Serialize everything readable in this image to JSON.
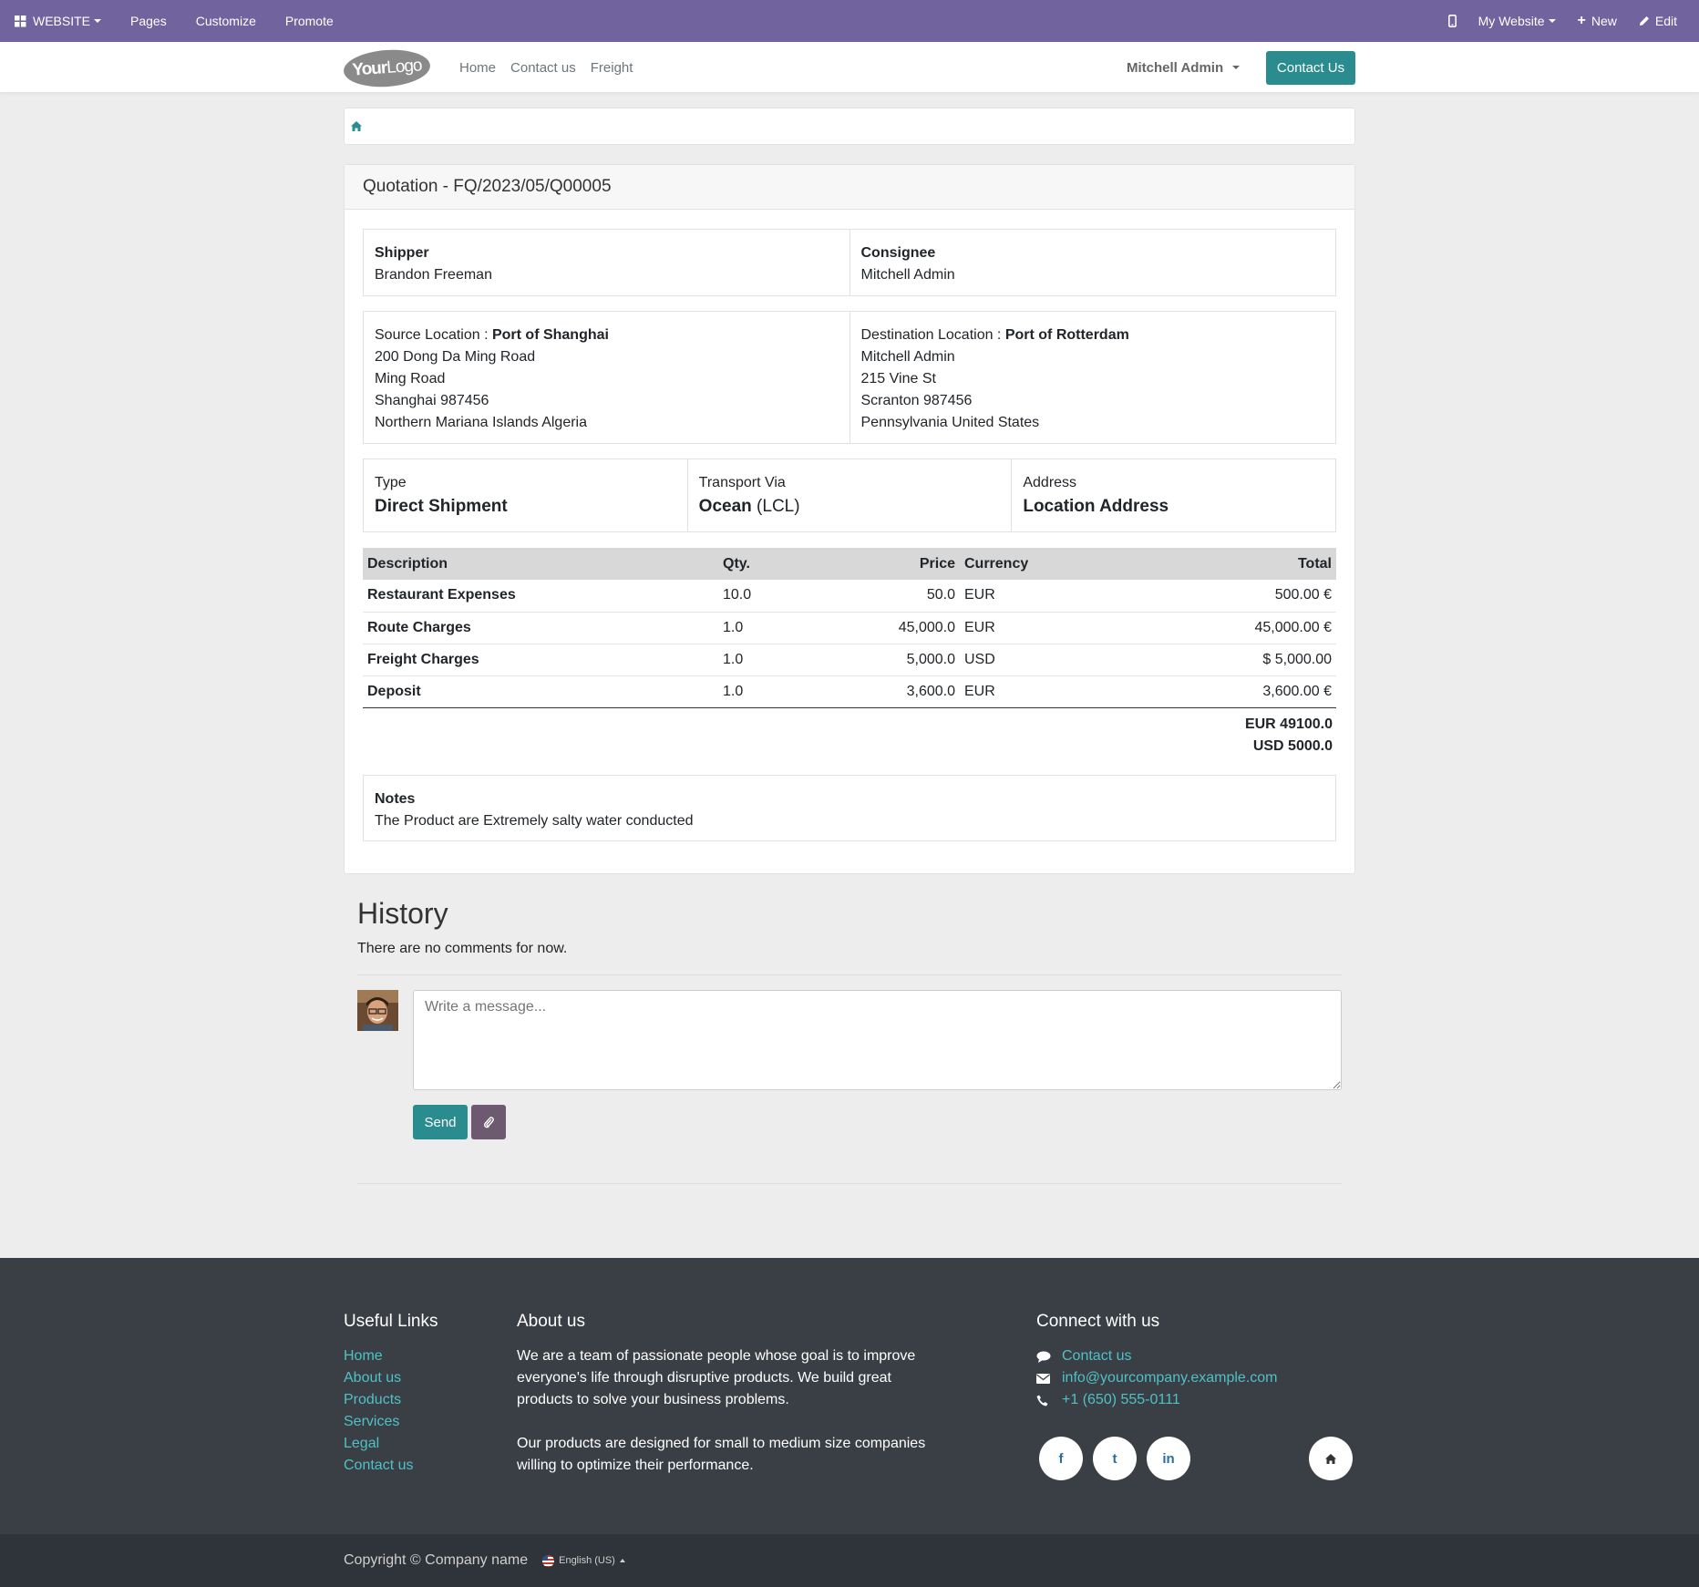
{
  "adminbar": {
    "website_label": "WEBSITE",
    "pages": "Pages",
    "customize": "Customize",
    "promote": "Promote",
    "my_website": "My Website",
    "new": "New",
    "edit": "Edit"
  },
  "header": {
    "logo_your": "Your",
    "logo_logo": "Logo",
    "nav": [
      "Home",
      "Contact us",
      "Freight"
    ],
    "user": "Mitchell Admin",
    "contact_button": "Contact Us"
  },
  "quotation": {
    "title": "Quotation - FQ/2023/05/Q00005",
    "shipper_label": "Shipper",
    "shipper": "Brandon Freeman",
    "consignee_label": "Consignee",
    "consignee": "Mitchell Admin",
    "source_label": "Source Location : ",
    "source_name": "Port of Shanghai",
    "source_lines": [
      "200 Dong Da Ming Road",
      "Ming Road",
      "Shanghai 987456",
      "Northern Mariana Islands Algeria"
    ],
    "dest_label": "Destination Location : ",
    "dest_name": "Port of Rotterdam",
    "dest_lines": [
      "Mitchell Admin",
      "215 Vine St",
      "Scranton 987456",
      "Pennsylvania United States"
    ],
    "type_label": "Type",
    "type_value": "Direct Shipment",
    "transport_label": "Transport Via",
    "transport_value": "Ocean",
    "transport_sub": "(LCL)",
    "address_label": "Address",
    "address_value": "Location Address",
    "columns": [
      "Description",
      "Qty.",
      "Price",
      "Currency",
      "Total"
    ],
    "lines": [
      {
        "description": "Restaurant Expenses",
        "qty": "10.0",
        "price": "50.0",
        "currency": "EUR",
        "total": "500.00 €"
      },
      {
        "description": "Route Charges",
        "qty": "1.0",
        "price": "45,000.0",
        "currency": "EUR",
        "total": "45,000.00 €"
      },
      {
        "description": "Freight Charges",
        "qty": "1.0",
        "price": "5,000.0",
        "currency": "USD",
        "total": "$ 5,000.00"
      },
      {
        "description": "Deposit",
        "qty": "1.0",
        "price": "3,600.0",
        "currency": "EUR",
        "total": "3,600.00 €"
      }
    ],
    "total_eur": "EUR 49100.0",
    "total_usd": "USD 5000.0",
    "notes_label": "Notes",
    "notes": "The Product are Extremely salty water conducted"
  },
  "history": {
    "title": "History",
    "empty": "There are no comments for now.",
    "placeholder": "Write a message...",
    "send": "Send"
  },
  "footer": {
    "useful_title": "Useful Links",
    "useful_links": [
      "Home",
      "About us",
      "Products",
      "Services",
      "Legal",
      "Contact us"
    ],
    "about_title": "About us",
    "about_p1": "We are a team of passionate people whose goal is to improve everyone's life through disruptive products. We build great products to solve your business problems.",
    "about_p2": "Our products are designed for small to medium size companies willing to optimize their performance.",
    "connect_title": "Connect with us",
    "contact_link": "Contact us",
    "email": "info@yourcompany.example.com",
    "phone": "+1 (650) 555-0111",
    "social": [
      "f",
      "t",
      "in"
    ]
  },
  "copyright": {
    "text": "Copyright © Company name",
    "language": "English (US)"
  },
  "colors": {
    "adminbar": "#71639e",
    "primary": "#2a8c8f",
    "footer": "#3a3f46",
    "link": "#4fc1c4"
  }
}
